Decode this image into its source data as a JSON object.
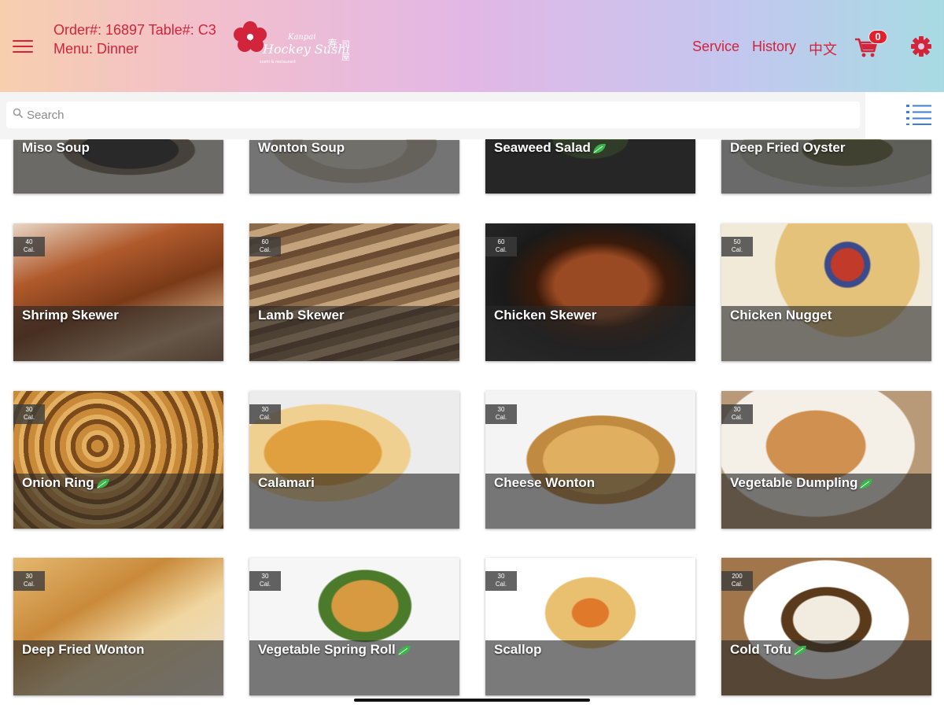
{
  "header": {
    "order_line": "Order#: 16897 Table#: C3",
    "menu_line": "Menu: Dinner",
    "logo_text": "Kanpai Hockey Sushi",
    "nav": [
      "Service",
      "History",
      "中文"
    ],
    "cart_count": "0",
    "accent_color": "#d2243a"
  },
  "search": {
    "placeholder": "Search"
  },
  "items": [
    {
      "name": "Miso Soup",
      "vegetarian": false
    },
    {
      "name": "Wonton Soup",
      "vegetarian": false
    },
    {
      "name": "Seaweed Salad",
      "vegetarian": true
    },
    {
      "name": "Deep Fried Oyster",
      "vegetarian": false
    },
    {
      "name": "Shrimp Skewer",
      "cal": "40",
      "cal_unit": "Cal.",
      "vegetarian": false
    },
    {
      "name": "Lamb Skewer",
      "cal": "60",
      "cal_unit": "Cal.",
      "vegetarian": false
    },
    {
      "name": "Chicken Skewer",
      "cal": "60",
      "cal_unit": "Cal.",
      "vegetarian": false
    },
    {
      "name": "Chicken Nugget",
      "cal": "50",
      "cal_unit": "Cal.",
      "vegetarian": false
    },
    {
      "name": "Onion Ring",
      "cal": "30",
      "cal_unit": "Cal.",
      "vegetarian": true
    },
    {
      "name": "Calamari",
      "cal": "30",
      "cal_unit": "Cal.",
      "vegetarian": false
    },
    {
      "name": "Cheese Wonton",
      "cal": "30",
      "cal_unit": "Cal.",
      "vegetarian": false
    },
    {
      "name": "Vegetable Dumpling",
      "cal": "30",
      "cal_unit": "Cal.",
      "vegetarian": true
    },
    {
      "name": "Deep Fried Wonton",
      "cal": "30",
      "cal_unit": "Cal.",
      "vegetarian": false
    },
    {
      "name": "Vegetable Spring Roll",
      "cal": "30",
      "cal_unit": "Cal.",
      "vegetarian": true
    },
    {
      "name": "Scallop",
      "cal": "30",
      "cal_unit": "Cal.",
      "vegetarian": false
    },
    {
      "name": "Cold Tofu",
      "cal": "200",
      "cal_unit": "Cal.",
      "vegetarian": true
    }
  ]
}
